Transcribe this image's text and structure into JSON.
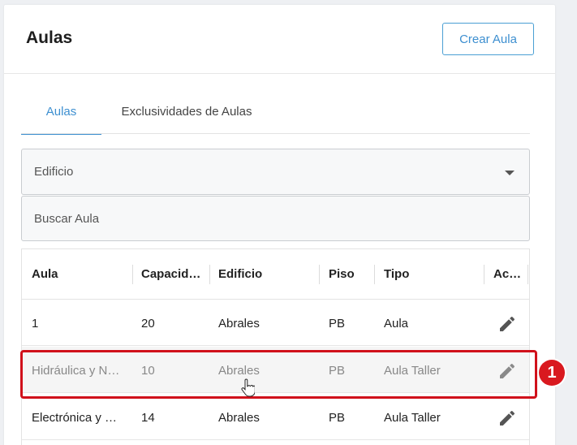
{
  "header": {
    "title": "Aulas",
    "create_button": "Crear Aula"
  },
  "tabs": [
    {
      "label": "Aulas",
      "active": true
    },
    {
      "label": "Exclusividades de Aulas",
      "active": false
    }
  ],
  "filters": {
    "edificio": {
      "label": "Edificio",
      "icon": "caret-down-icon"
    },
    "buscar": {
      "placeholder": "Buscar Aula",
      "value": ""
    }
  },
  "table": {
    "columns": [
      "Aula",
      "Capacid…",
      "Edificio",
      "Piso",
      "Tipo",
      "Ac…"
    ],
    "rows": [
      {
        "aula": "1",
        "capacidad": "20",
        "edificio": "Abrales",
        "piso": "PB",
        "tipo": "Aula",
        "action_icon": "pencil-icon"
      },
      {
        "aula": "Hidráulica y N…",
        "capacidad": "10",
        "edificio": "Abrales",
        "piso": "PB",
        "tipo": "Aula Taller",
        "action_icon": "pencil-icon"
      },
      {
        "aula": "Electrónica y …",
        "capacidad": "14",
        "edificio": "Abrales",
        "piso": "PB",
        "tipo": "Aula Taller",
        "action_icon": "pencil-icon"
      }
    ]
  },
  "annotation": {
    "badge": "1",
    "color": "#d0111b"
  },
  "colors": {
    "accent": "#3d8fd0",
    "highlight": "#d0111b"
  }
}
